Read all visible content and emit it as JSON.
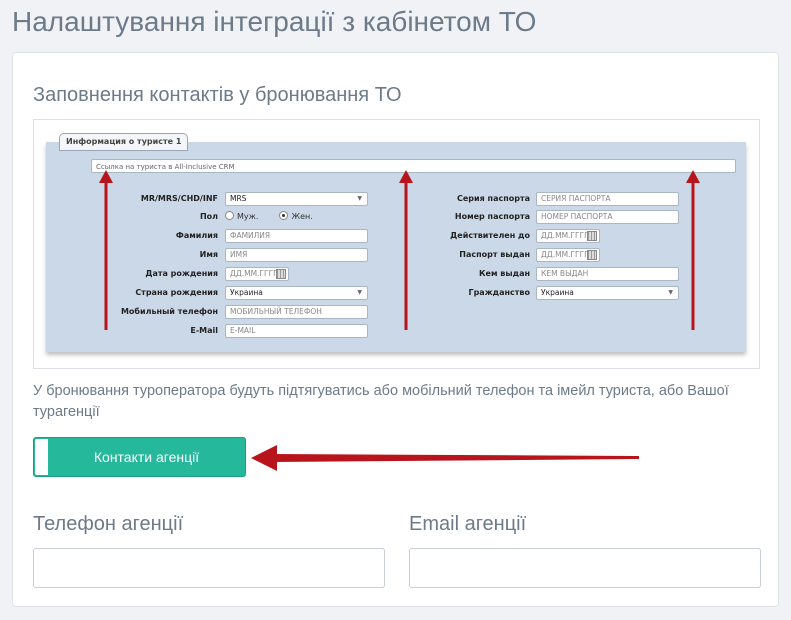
{
  "page": {
    "title": "Налаштування інтеграції з кабінетом ТО"
  },
  "section": {
    "title": "Заповнення контактів у бронювання ТО"
  },
  "screenshot": {
    "tab_label": "Информация о туристе 1",
    "url_placeholder": "Ссылка на туриста в All-Inclusive CRM",
    "left_fields": [
      {
        "label": "MR/MRS/CHD/INF",
        "value": "MRS",
        "type": "select"
      },
      {
        "label": "Пол",
        "type": "radio",
        "options": [
          "Муж.",
          "Жен."
        ],
        "selected": "Жен."
      },
      {
        "label": "Фамилия",
        "value": "ФАМИЛИЯ",
        "type": "input"
      },
      {
        "label": "Имя",
        "value": "ИМЯ",
        "type": "input"
      },
      {
        "label": "Дата рождения",
        "value": "ДД.ММ.ГГГГ",
        "type": "date"
      },
      {
        "label": "Страна рождения",
        "value": "Украина",
        "type": "select"
      },
      {
        "label": "Мобильный телефон",
        "value": "МОБИЛЬНЫЙ ТЕЛЕФОН",
        "type": "input"
      },
      {
        "label": "E-Mail",
        "value": "E-MAIL",
        "type": "input"
      }
    ],
    "right_fields": [
      {
        "label": "Серия паспорта",
        "value": "СЕРИЯ ПАСПОРТА",
        "type": "input"
      },
      {
        "label": "Номер паспорта",
        "value": "НОМЕР ПАСПОРТА",
        "type": "input"
      },
      {
        "label": "Действителен до",
        "value": "ДД.ММ.ГГГГ",
        "type": "date"
      },
      {
        "label": "Паспорт выдан",
        "value": "ДД.ММ.ГГГГ",
        "type": "date"
      },
      {
        "label": "Кем выдан",
        "value": "КЕМ ВЫДАН",
        "type": "input"
      },
      {
        "label": "Гражданство",
        "value": "Украина",
        "type": "select"
      }
    ]
  },
  "note": "У бронювання туроператора будуть підтягуватись або мобільний телефон та імейл туриста, або Вашої турагенції",
  "agency_toggle": {
    "label": "Контакти агенції"
  },
  "phone_field": {
    "label": "Телефон агенції",
    "value": "",
    "placeholder": ""
  },
  "email_field": {
    "label": "Email агенції",
    "value": "",
    "placeholder": ""
  },
  "colors": {
    "accent": "#26b89a",
    "arrow": "#b8141b",
    "text_muted": "#6c7a89",
    "panel": "#cad8e7"
  }
}
